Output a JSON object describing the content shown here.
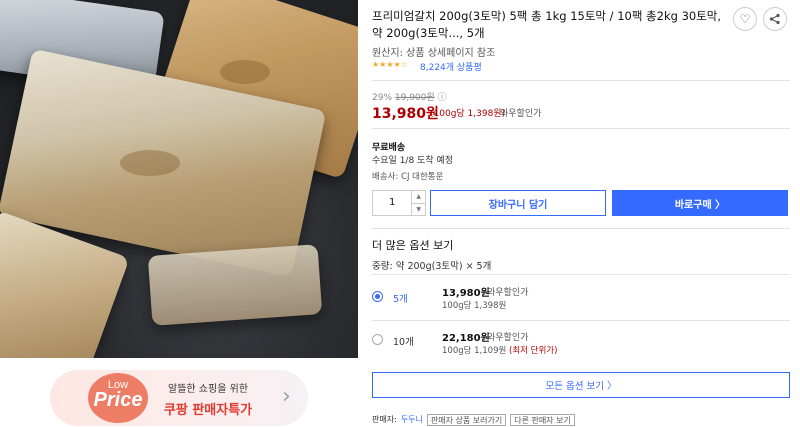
{
  "banner": {
    "low": "Low",
    "price": "Price",
    "line1": "알뜰한 쇼핑을 위한",
    "line2": "쿠팡 판매자특가",
    "chevron": "›"
  },
  "product": {
    "title": "프리미엄갈치 200g(3토막) 5팩 총 1kg 15토막 / 10팩 총2kg 30토막, 약 200g(3토막..., 5개",
    "origin": "원산지: 상품 상세페이지 참조",
    "stars": "★★★★☆",
    "rating": 4,
    "reviews": "8,224개 상품평",
    "favorite_icon": "♡",
    "share_icon": "⋖"
  },
  "pricing": {
    "discount_rate": "29%",
    "original_price": "19,900원",
    "info_icon": "ⓘ",
    "price": "13,980원",
    "unit_price": "(100g당 1,398원)",
    "wow": "와우할인가"
  },
  "shipping": {
    "label": "무료배송",
    "arrival": "수요일 1/8 도착 예정",
    "seller": "배송사: CJ 대한통운"
  },
  "purchase": {
    "quantity": "1",
    "cart_label": "장바구니 담기",
    "buy_label": "바로구매 〉"
  },
  "options": {
    "title": "더 많은 옵션 보기",
    "label": "중량: 약 200g(3토막) × 5개",
    "items": [
      {
        "name": "5개",
        "price": "13,980원",
        "wow": "와우할인가",
        "unit": "100g당 1,398원",
        "best": "",
        "selected": true
      },
      {
        "name": "10개",
        "price": "22,180원",
        "wow": "와우할인가",
        "unit": "100g당 1,109원",
        "best": "(최저 단위가)",
        "selected": false
      }
    ],
    "all_label": "모든 옵션 보기 〉"
  },
  "seller_row": {
    "label": "판매자:",
    "name": "두두니",
    "tag1": "판매자 상품 보러가기",
    "tag2": "다른 판매자 보기"
  },
  "colors": {
    "accent": "#346aff",
    "price_red": "#ae0000",
    "banner_red": "#e23a2e"
  }
}
